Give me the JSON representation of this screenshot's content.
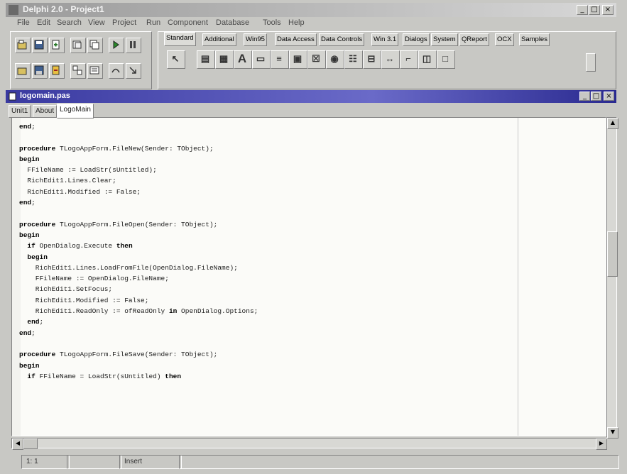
{
  "window": {
    "title": "Delphi 2.0 - Project1"
  },
  "menu": [
    "File",
    "Edit",
    "Search",
    "View",
    "Project",
    "Run",
    "Component",
    "Database",
    "Tools",
    "Help"
  ],
  "palette": {
    "tabs": [
      "Standard",
      "Additional",
      "Win95",
      "Data Access",
      "Data Controls",
      "Win 3.1",
      "Dialogs",
      "System",
      "QReport",
      "OCX",
      "Samples"
    ],
    "active_tab": "Standard"
  },
  "editor": {
    "title": "logomain.pas",
    "tabs": [
      "Unit1",
      "About",
      "LogoMain"
    ],
    "active_tab": "LogoMain",
    "code_lines": [
      "end;",
      "",
      "procedure TLogoAppForm.FileNew(Sender: TObject);",
      "begin",
      "  FFileName := LoadStr(sUntitled);",
      "  RichEdit1.Lines.Clear;",
      "  RichEdit1.Modified := False;",
      "end;",
      "",
      "procedure TLogoAppForm.FileOpen(Sender: TObject);",
      "begin",
      "  if OpenDialog.Execute then",
      "  begin",
      "    RichEdit1.Lines.LoadFromFile(OpenDialog.FileName);",
      "    FFileName := OpenDialog.FileName;",
      "    RichEdit1.SetFocus;",
      "    RichEdit1.Modified := False;",
      "    RichEdit1.ReadOnly := ofReadOnly in OpenDialog.Options;",
      "  end;",
      "end;",
      "",
      "procedure TLogoAppForm.FileSave(Sender: TObject);",
      "begin",
      "  if FFileName = LoadStr(sUntitled) then"
    ]
  },
  "status": {
    "position": "1: 1",
    "mode": "Insert"
  },
  "icons": {
    "speedbar": [
      "open-project-icon",
      "save-icon",
      "add-file-icon",
      "open-icon",
      "save-all-icon",
      "run-icon",
      "pause-icon",
      "open-file-icon",
      "save-file-icon",
      "remove-file-icon",
      "toggle-form-icon",
      "select-unit-icon",
      "step-over-icon",
      "trace-into-icon"
    ],
    "palette": [
      "pointer-icon",
      "mainmenu-icon",
      "popupmenu-icon",
      "label-icon",
      "edit-icon",
      "memo-icon",
      "button-icon",
      "checkbox-icon",
      "radiobutton-icon",
      "listbox-icon",
      "combobox-icon",
      "scrollbar-icon",
      "groupbox-icon",
      "radiogroup-icon",
      "panel-icon"
    ]
  },
  "colors": {
    "editor_titlebar": "#3a3aa0",
    "keyword": "#000000",
    "code_text": "#202020"
  }
}
